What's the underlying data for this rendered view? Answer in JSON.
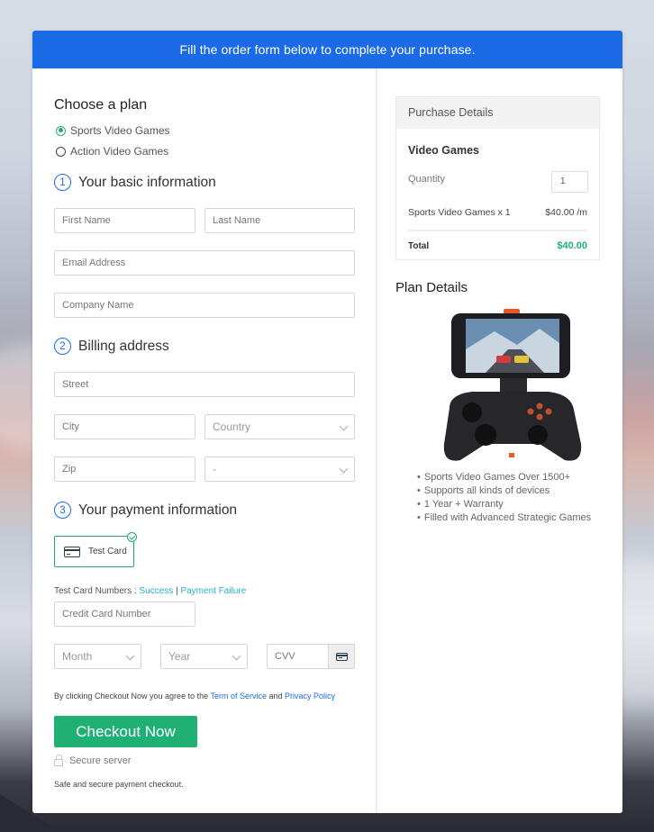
{
  "banner": {
    "text": "Fill the order form below to complete your purchase."
  },
  "plan": {
    "title": "Choose a plan",
    "options": [
      {
        "label": "Sports Video Games",
        "selected": true
      },
      {
        "label": "Action Video Games",
        "selected": false
      }
    ]
  },
  "basic_info": {
    "step": "1",
    "title": "Your basic information",
    "first_name_placeholder": "First Name",
    "last_name_placeholder": "Last Name",
    "email_placeholder": "Email Address",
    "company_placeholder": "Company Name"
  },
  "billing": {
    "step": "2",
    "title": "Billing address",
    "street_placeholder": "Street",
    "city_placeholder": "City",
    "country_selected": "Country",
    "zip_placeholder": "Zip",
    "state_selected": "-"
  },
  "payment": {
    "step": "3",
    "title": "Your payment information",
    "method_label": "Test Card",
    "test_numbers_label": "Test Card Numbers :",
    "success_link": "Success",
    "separator": "|",
    "failure_link": "Payment Failure",
    "card_number_placeholder": "Credit Card Number",
    "month_selected": "Month",
    "year_selected": "Year",
    "cvv_placeholder": "CVV"
  },
  "terms": {
    "prefix": "By clicking Checkout Now you agree to the",
    "tos_link": "Term of Service",
    "and": "and",
    "privacy_link": "Privacy Policy"
  },
  "checkout": {
    "button_label": "Checkout Now",
    "secure_label": "Secure server",
    "safe_text": "Safe and secure payment checkout."
  },
  "purchase_details": {
    "header": "Purchase Details",
    "product_title": "Video Games",
    "quantity_label": "Quantity",
    "quantity_value": "1",
    "line_item": "Sports Video Games x 1",
    "line_price": "$40.00 /m",
    "total_label": "Total",
    "total_value": "$40.00"
  },
  "plan_details": {
    "title": "Plan Details",
    "image_alt": "Smartphone mounted on game controller",
    "features": [
      "Sports Video Games Over 1500+",
      "Supports all kinds of devices",
      "1 Year + Warranty",
      "Filled with Advanced Strategic Games"
    ]
  },
  "colors": {
    "primary": "#1c6be6",
    "success": "#20b073",
    "link": "#2ab0c5"
  }
}
